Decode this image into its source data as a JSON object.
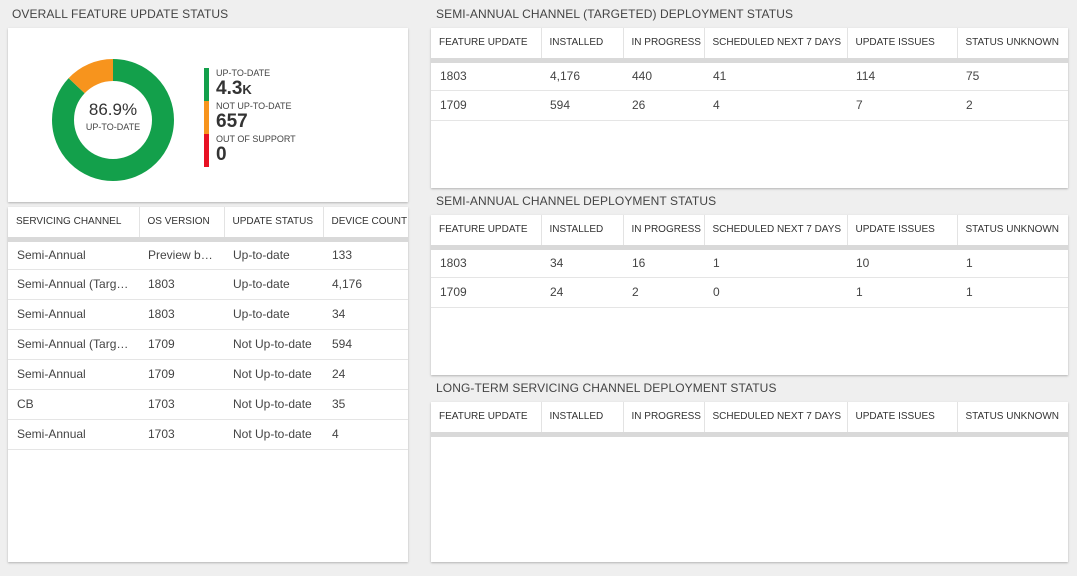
{
  "overall": {
    "title": "OVERALL FEATURE UPDATE STATUS",
    "percent": "86.9%",
    "percent_label": "UP-TO-DATE",
    "legend": [
      {
        "label": "UP-TO-DATE",
        "value": "4.3",
        "suffix": "K",
        "color": "#13a04b"
      },
      {
        "label": "NOT UP-TO-DATE",
        "value": "657",
        "suffix": "",
        "color": "#f7941d"
      },
      {
        "label": "OUT OF SUPPORT",
        "value": "0",
        "suffix": "",
        "color": "#e81123"
      }
    ],
    "donut_fractions": [
      0.869,
      0.131,
      0.0
    ],
    "colors": {
      "up": "#13a04b",
      "not_up": "#f7941d",
      "out": "#e81123"
    }
  },
  "servicing": {
    "headers": [
      "SERVICING CHANNEL",
      "OS VERSION",
      "UPDATE STATUS",
      "DEVICE COUNT"
    ],
    "rows": [
      [
        "Semi-Annual",
        "Preview build",
        "Up-to-date",
        "133"
      ],
      [
        "Semi-Annual (Targeted)",
        "1803",
        "Up-to-date",
        "4,176"
      ],
      [
        "Semi-Annual",
        "1803",
        "Up-to-date",
        "34"
      ],
      [
        "Semi-Annual (Targeted)",
        "1709",
        "Not Up-to-date",
        "594"
      ],
      [
        "Semi-Annual",
        "1709",
        "Not Up-to-date",
        "24"
      ],
      [
        "CB",
        "1703",
        "Not Up-to-date",
        "35"
      ],
      [
        "Semi-Annual",
        "1703",
        "Not Up-to-date",
        "4"
      ]
    ]
  },
  "targeted": {
    "title": "SEMI-ANNUAL CHANNEL (TARGETED) DEPLOYMENT STATUS",
    "headers": [
      "FEATURE UPDATE",
      "INSTALLED",
      "IN PROGRESS",
      "SCHEDULED NEXT 7 DAYS",
      "UPDATE ISSUES",
      "STATUS UNKNOWN"
    ],
    "rows": [
      [
        "1803",
        "4,176",
        "440",
        "41",
        "114",
        "75"
      ],
      [
        "1709",
        "594",
        "26",
        "4",
        "7",
        "2"
      ]
    ]
  },
  "semiannual": {
    "title": "SEMI-ANNUAL CHANNEL DEPLOYMENT STATUS",
    "headers": [
      "FEATURE UPDATE",
      "INSTALLED",
      "IN PROGRESS",
      "SCHEDULED NEXT 7 DAYS",
      "UPDATE ISSUES",
      "STATUS UNKNOWN"
    ],
    "rows": [
      [
        "1803",
        "34",
        "16",
        "1",
        "10",
        "1"
      ],
      [
        "1709",
        "24",
        "2",
        "0",
        "1",
        "1"
      ]
    ]
  },
  "ltsc": {
    "title": "LONG-TERM SERVICING CHANNEL DEPLOYMENT STATUS",
    "headers": [
      "FEATURE UPDATE",
      "INSTALLED",
      "IN PROGRESS",
      "SCHEDULED NEXT 7 DAYS",
      "UPDATE ISSUES",
      "STATUS UNKNOWN"
    ],
    "rows": []
  }
}
